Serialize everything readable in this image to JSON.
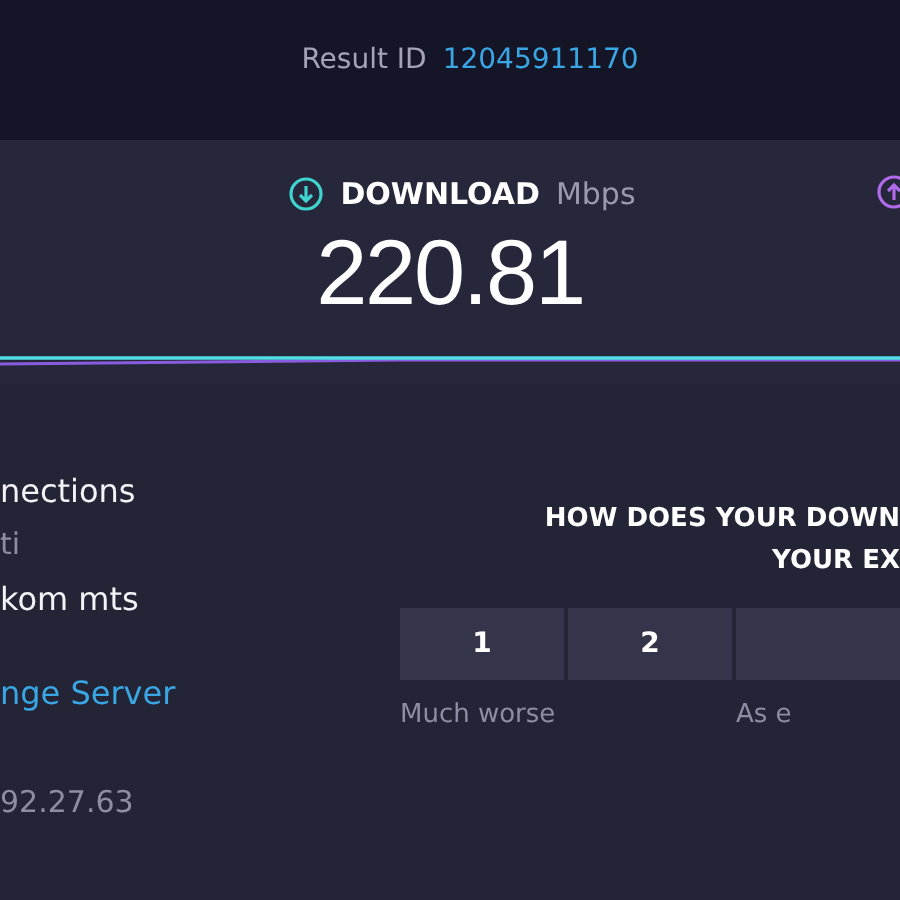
{
  "result": {
    "label": "Result ID",
    "id": "12045911170"
  },
  "download": {
    "title": "DOWNLOAD",
    "unit": "Mbps",
    "value": "220.81"
  },
  "connection_info": [
    {
      "kind": "primary",
      "text": "nections"
    },
    {
      "kind": "secondary",
      "text": "ti"
    },
    {
      "kind": "primary",
      "text": "kom mts"
    },
    {
      "kind": "link",
      "text": "nge Server"
    },
    {
      "kind": "secondary",
      "text": "92.27.63"
    }
  ],
  "survey": {
    "question_lines": [
      "HOW DOES YOUR DOWN",
      "YOUR EX"
    ],
    "ratings": [
      {
        "kind": "button",
        "label": "1"
      },
      {
        "kind": "button",
        "label": "2"
      },
      {
        "kind": "partial"
      }
    ],
    "scale_labels": [
      "Much worse",
      "As e"
    ]
  }
}
